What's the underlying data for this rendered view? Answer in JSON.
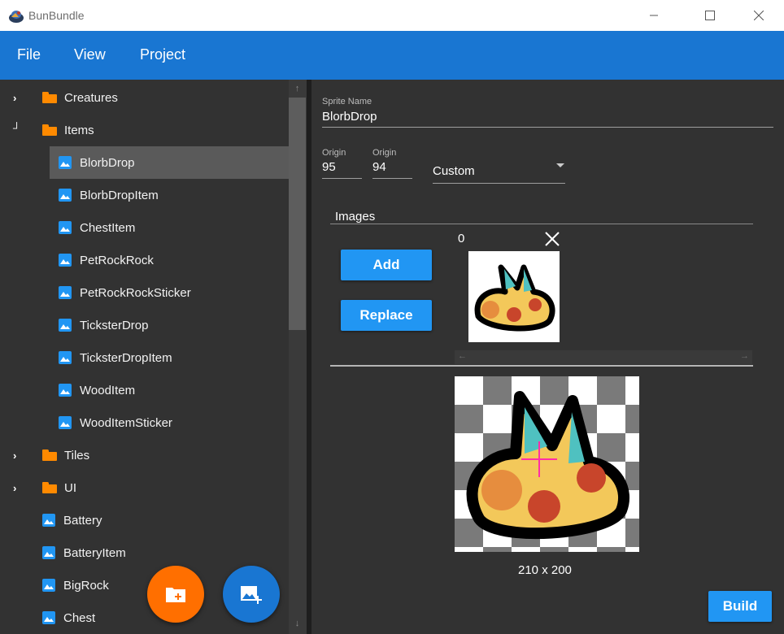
{
  "window": {
    "title": "BunBundle"
  },
  "menu": {
    "items": [
      "File",
      "View",
      "Project"
    ]
  },
  "tree": {
    "items": [
      {
        "label": "Creatures",
        "type": "folder",
        "state": "collapsed"
      },
      {
        "label": "Items",
        "type": "folder",
        "state": "expanded"
      },
      {
        "label": "BlorbDrop",
        "type": "sprite",
        "selected": true
      },
      {
        "label": "BlorbDropItem",
        "type": "sprite"
      },
      {
        "label": "ChestItem",
        "type": "sprite"
      },
      {
        "label": "PetRockRock",
        "type": "sprite"
      },
      {
        "label": "PetRockRockSticker",
        "type": "sprite"
      },
      {
        "label": "TicksterDrop",
        "type": "sprite"
      },
      {
        "label": "TicksterDropItem",
        "type": "sprite"
      },
      {
        "label": "WoodItem",
        "type": "sprite"
      },
      {
        "label": "WoodItemSticker",
        "type": "sprite"
      },
      {
        "label": "Tiles",
        "type": "folder",
        "state": "collapsed"
      },
      {
        "label": "UI",
        "type": "folder",
        "state": "collapsed"
      },
      {
        "label": "Battery",
        "type": "sprite"
      },
      {
        "label": "BatteryItem",
        "type": "sprite"
      },
      {
        "label": "BigRock",
        "type": "sprite"
      },
      {
        "label": "Chest",
        "type": "sprite"
      }
    ]
  },
  "fabs": {
    "add_folder_icon": "add-folder-icon",
    "add_sprite_icon": "add-image-icon"
  },
  "editor": {
    "sprite_name_label": "Sprite Name",
    "sprite_name_value": "BlorbDrop",
    "origin_x_label": "Origin",
    "origin_x_value": "95",
    "origin_y_label": "Origin",
    "origin_y_value": "94",
    "origin_mode": "Custom",
    "images_label": "Images",
    "image_index": "0",
    "add_label": "Add",
    "replace_label": "Replace",
    "preview_size": "210 x 200",
    "build_label": "Build"
  },
  "colors": {
    "accent": "#1976d2",
    "button": "#2196f3",
    "folder": "#ff8a00",
    "fab_folder": "#ff6f00",
    "fab_image": "#1976d2"
  }
}
